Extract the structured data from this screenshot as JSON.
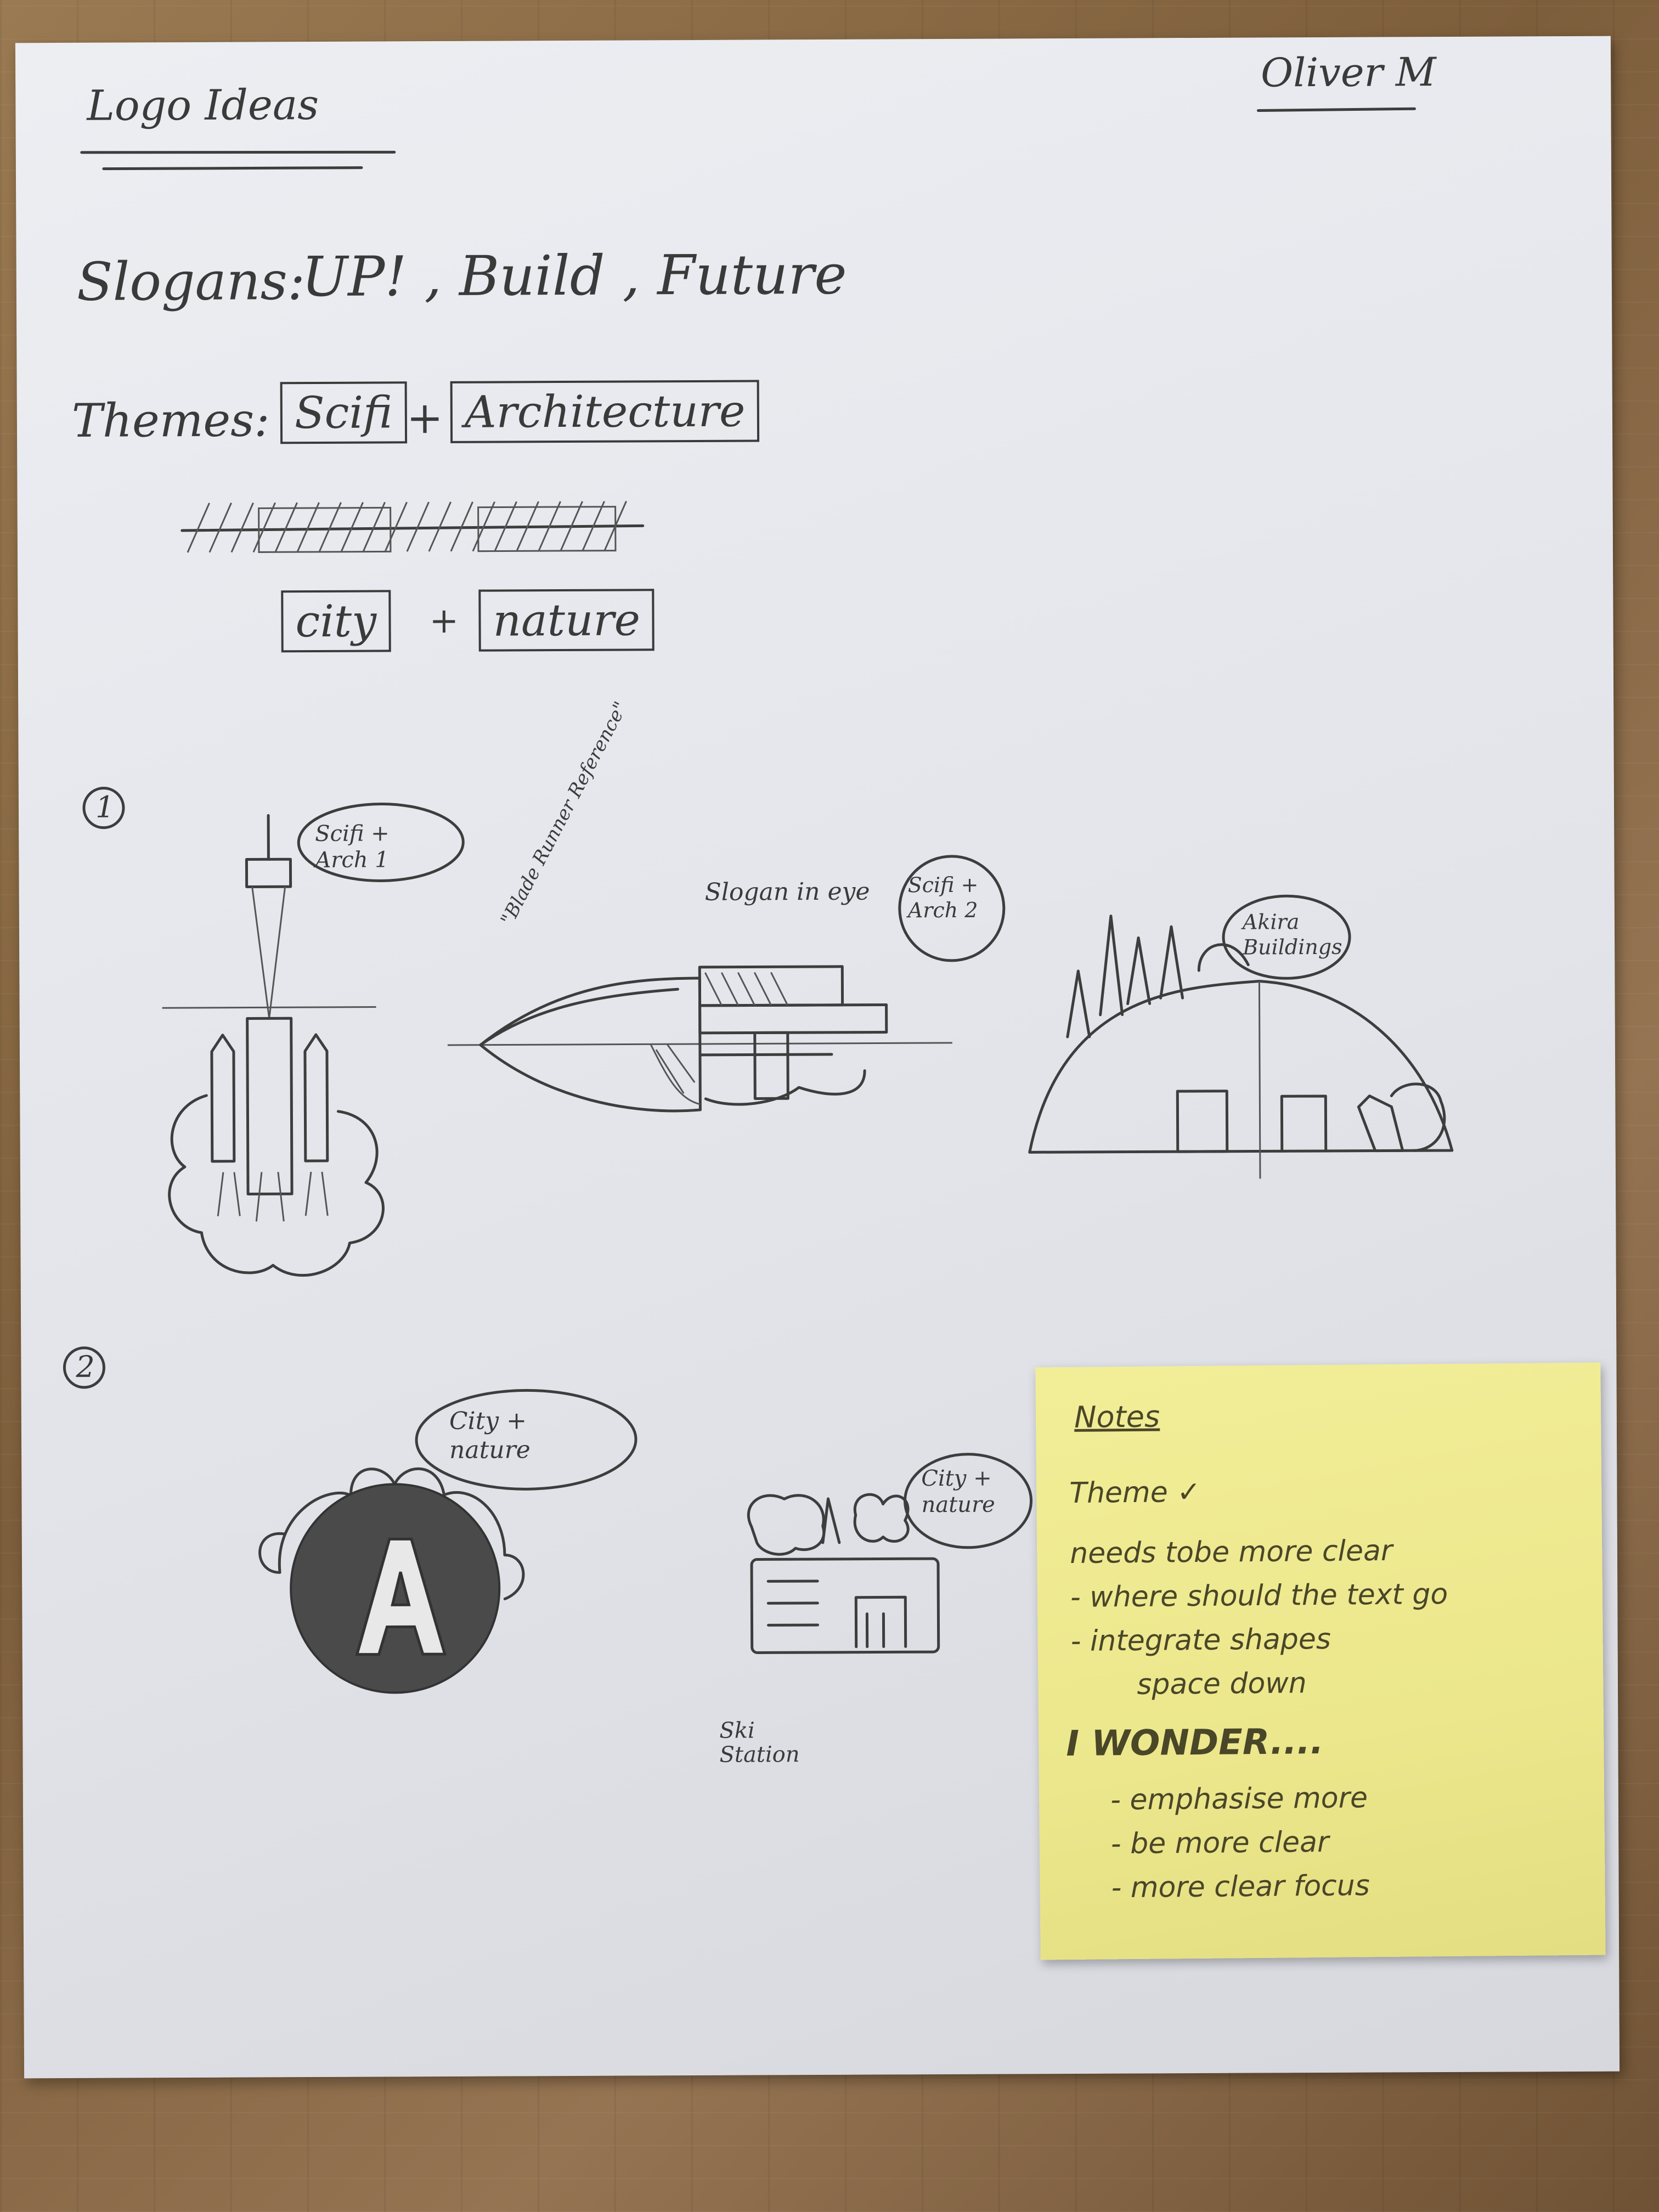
{
  "page": {
    "title": "Logo Ideas",
    "author": "Oliver M",
    "slogans_label": "Slogans:",
    "slogans": "UP! , Build , Future",
    "themes_label": "Themes:",
    "themes_row1": [
      "Scifi",
      "Architecture"
    ],
    "themes_row2": [
      "city",
      "nature"
    ],
    "plus": "+",
    "section1_marker": "1",
    "section2_marker": "2"
  },
  "sketches": {
    "rocket_bubble": "Scifi + Arch 1",
    "ship_note": "\"Blade Runner Reference\"",
    "ship_slogan_note": "Slogan in eye",
    "ship_bubble": "Scifi + Arch 2",
    "dome_bubble": "Akira Buildings",
    "circle_bubble": "City + nature",
    "circle_letter": "A",
    "planter_bubble": "City + nature",
    "planter_caption": "Ski Station"
  },
  "sticky_note": {
    "title": "Notes",
    "lines": [
      "Theme ✓",
      "needs tobe more clear",
      "- where should the text go",
      "- integrate shapes",
      "space down",
      "I WONDER....",
      "- emphasise more",
      "- be more clear",
      "- more clear focus"
    ]
  }
}
